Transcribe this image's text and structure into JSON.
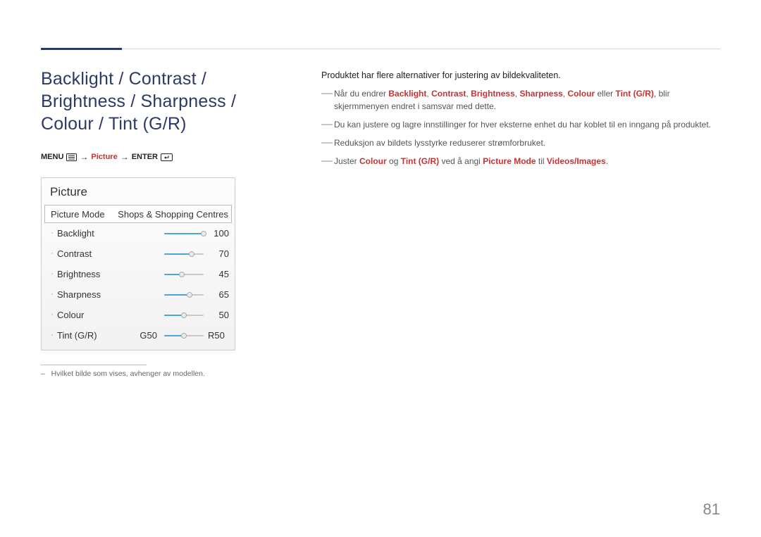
{
  "title": "Backlight / Contrast / Brightness / Sharpness / Colour / Tint (G/R)",
  "breadcrumb": {
    "menu": "MENU",
    "picture": "Picture",
    "enter": "ENTER",
    "arrow": "→"
  },
  "panel": {
    "title": "Picture",
    "mode_label": "Picture Mode",
    "mode_value": "Shops & Shopping Centres",
    "sliders": [
      {
        "label": "Backlight",
        "value": 100,
        "max": 100
      },
      {
        "label": "Contrast",
        "value": 70,
        "max": 100
      },
      {
        "label": "Brightness",
        "value": 45,
        "max": 100
      },
      {
        "label": "Sharpness",
        "value": 65,
        "max": 100
      },
      {
        "label": "Colour",
        "value": 50,
        "max": 100
      }
    ],
    "tint": {
      "label": "Tint (G/R)",
      "left": "G50",
      "right": "R50",
      "value": 50,
      "max": 100
    }
  },
  "footnote_dash": "–",
  "footnote": "Hvilket bilde som vises, avhenger av modellen.",
  "body": {
    "intro": "Produktet har flere alternativer for justering av bildekvaliteten.",
    "note1_a": "Når du endrer ",
    "note1_b": ", blir skjermmenyen endret i samsvar med dette.",
    "note1_terms": [
      "Backlight",
      "Contrast",
      "Brightness",
      "Sharpness",
      "Colour"
    ],
    "note1_or": " eller ",
    "note1_last": "Tint (G/R)",
    "note2": "Du kan justere og lagre innstillinger for hver eksterne enhet du har koblet til en inngang på produktet.",
    "note3": "Reduksjon av bildets lysstyrke reduserer strømforbruket.",
    "note4_a": "Juster ",
    "note4_colour": "Colour",
    "note4_b": " og ",
    "note4_tint": "Tint (G/R)",
    "note4_c": " ved å angi ",
    "note4_pm": "Picture Mode",
    "note4_d": " til ",
    "note4_vi": "Videos/Images",
    "note4_e": "."
  },
  "sep": ", ",
  "page_number": "81"
}
